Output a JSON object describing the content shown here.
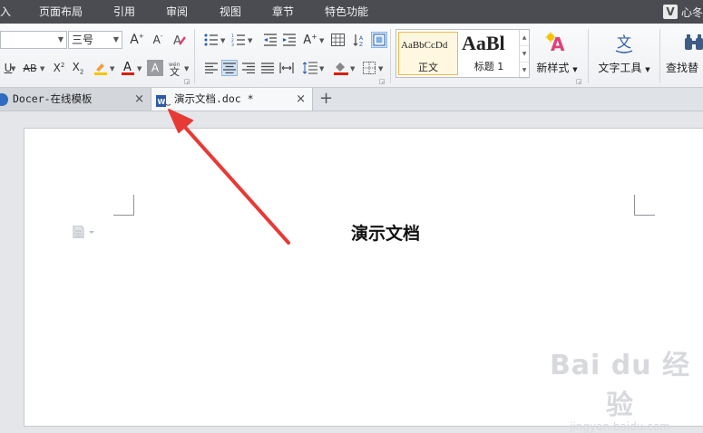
{
  "menu": {
    "items": [
      "入",
      "页面布局",
      "引用",
      "审阅",
      "视图",
      "章节",
      "特色功能"
    ],
    "user_badge": "V",
    "user_name": "心冬"
  },
  "ribbon": {
    "font_name": "",
    "font_size": "三号",
    "styles": [
      {
        "preview": "AaBbCcDd",
        "label": "正文"
      },
      {
        "preview": "AaBl",
        "label": "标题 1"
      }
    ],
    "new_style_label": "新样式",
    "text_tools_label": "文字工具",
    "find_replace_label": "查找替"
  },
  "tabs": [
    {
      "label": "Docer-在线模板",
      "close": "×"
    },
    {
      "label": "演示文档.doc *",
      "close": "×"
    }
  ],
  "new_tab": "+",
  "document": {
    "title": "演示文档"
  },
  "watermark": {
    "line1": "Bai du 经验",
    "line2": "jingyan.baidu.com"
  },
  "colors": {
    "menubar": "#4a4c51",
    "active_tab": "#f7f8fa",
    "annotation_arrow": "#e83a35",
    "highlight_yellow": "#f5c400",
    "font_red": "#d81e06"
  }
}
